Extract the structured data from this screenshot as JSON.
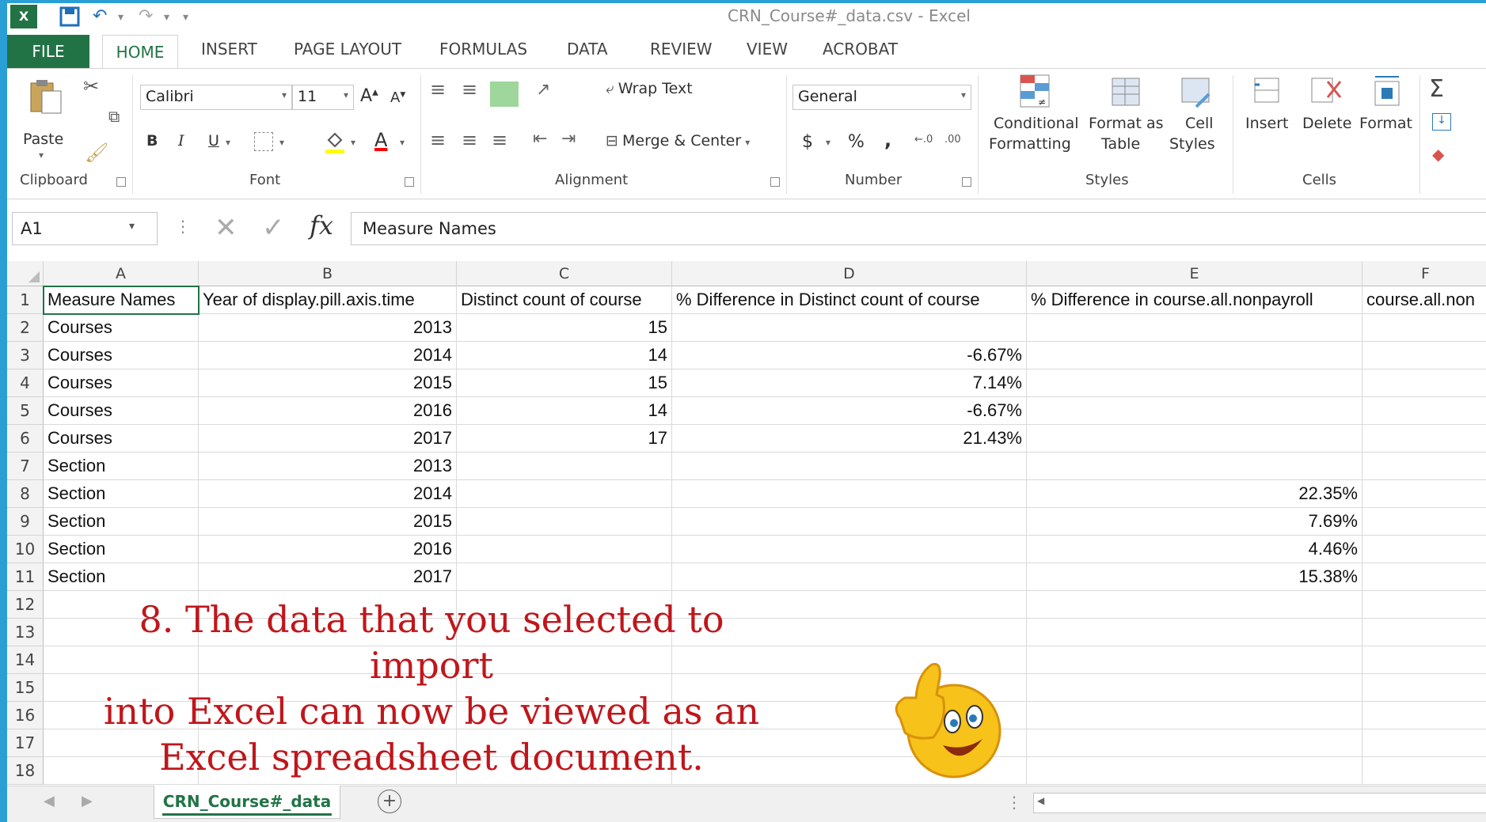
{
  "window": {
    "title": "CRN_Course#_data.csv - Excel"
  },
  "tabs": [
    "FILE",
    "HOME",
    "INSERT",
    "PAGE LAYOUT",
    "FORMULAS",
    "DATA",
    "REVIEW",
    "VIEW",
    "ACROBAT"
  ],
  "ribbon": {
    "clipboard": {
      "paste": "Paste",
      "label": "Clipboard"
    },
    "font": {
      "name": "Calibri",
      "size": "11",
      "bold": "B",
      "italic": "I",
      "underline": "U",
      "font_color_glyph": "A",
      "label": "Font"
    },
    "alignment": {
      "wrap": "Wrap Text",
      "merge": "Merge & Center",
      "label": "Alignment"
    },
    "number": {
      "format": "General",
      "currency": "$",
      "percent": "%",
      "comma": ",",
      "label": "Number"
    },
    "styles": {
      "conditional_1": "Conditional",
      "conditional_2": "Formatting",
      "format_as_1": "Format as",
      "format_as_2": "Table",
      "cell_1": "Cell",
      "cell_2": "Styles",
      "label": "Styles"
    },
    "cells": {
      "insert": "Insert",
      "delete": "Delete",
      "format": "Format",
      "label": "Cells"
    }
  },
  "formula_bar": {
    "name_box": "A1",
    "fx": "fx",
    "value": "Measure Names"
  },
  "columns": [
    "A",
    "B",
    "C",
    "D",
    "E",
    "F"
  ],
  "rows": [
    {
      "n": "1",
      "a": "Measure Names",
      "b": "Year of display.pill.axis.time",
      "c": "Distinct count of course",
      "d": "% Difference in Distinct count of course",
      "e": "% Difference in course.all.nonpayroll",
      "f": "course.all.non"
    },
    {
      "n": "2",
      "a": "Courses",
      "b": "2013",
      "c": "15",
      "d": "",
      "e": "",
      "f": ""
    },
    {
      "n": "3",
      "a": "Courses",
      "b": "2014",
      "c": "14",
      "d": "-6.67%",
      "e": "",
      "f": ""
    },
    {
      "n": "4",
      "a": "Courses",
      "b": "2015",
      "c": "15",
      "d": "7.14%",
      "e": "",
      "f": ""
    },
    {
      "n": "5",
      "a": "Courses",
      "b": "2016",
      "c": "14",
      "d": "-6.67%",
      "e": "",
      "f": ""
    },
    {
      "n": "6",
      "a": "Courses",
      "b": "2017",
      "c": "17",
      "d": "21.43%",
      "e": "",
      "f": ""
    },
    {
      "n": "7",
      "a": "Section",
      "b": "2013",
      "c": "",
      "d": "",
      "e": "",
      "f": ""
    },
    {
      "n": "8",
      "a": "Section",
      "b": "2014",
      "c": "",
      "d": "",
      "e": "22.35%",
      "f": ""
    },
    {
      "n": "9",
      "a": "Section",
      "b": "2015",
      "c": "",
      "d": "",
      "e": "7.69%",
      "f": ""
    },
    {
      "n": "10",
      "a": "Section",
      "b": "2016",
      "c": "",
      "d": "",
      "e": "4.46%",
      "f": ""
    },
    {
      "n": "11",
      "a": "Section",
      "b": "2017",
      "c": "",
      "d": "",
      "e": "15.38%",
      "f": ""
    },
    {
      "n": "12",
      "a": "",
      "b": "",
      "c": "",
      "d": "",
      "e": "",
      "f": ""
    },
    {
      "n": "13",
      "a": "",
      "b": "",
      "c": "",
      "d": "",
      "e": "",
      "f": ""
    },
    {
      "n": "14",
      "a": "",
      "b": "",
      "c": "",
      "d": "",
      "e": "",
      "f": ""
    },
    {
      "n": "15",
      "a": "",
      "b": "",
      "c": "",
      "d": "",
      "e": "",
      "f": ""
    },
    {
      "n": "16",
      "a": "",
      "b": "",
      "c": "",
      "d": "",
      "e": "",
      "f": ""
    },
    {
      "n": "17",
      "a": "",
      "b": "",
      "c": "",
      "d": "",
      "e": "",
      "f": ""
    },
    {
      "n": "18",
      "a": "",
      "b": "",
      "c": "",
      "d": "",
      "e": "",
      "f": ""
    }
  ],
  "caption": {
    "line1": "8. The data that you selected to import",
    "line2": "into Excel can now be viewed as an",
    "line3": "Excel spreadsheet document."
  },
  "sheet_tabs": {
    "active": "CRN_Course#_data",
    "add": "+"
  },
  "colors": {
    "excel_green": "#217346",
    "caption_red": "#c0161b",
    "background_blue": "#2a9fd6"
  }
}
